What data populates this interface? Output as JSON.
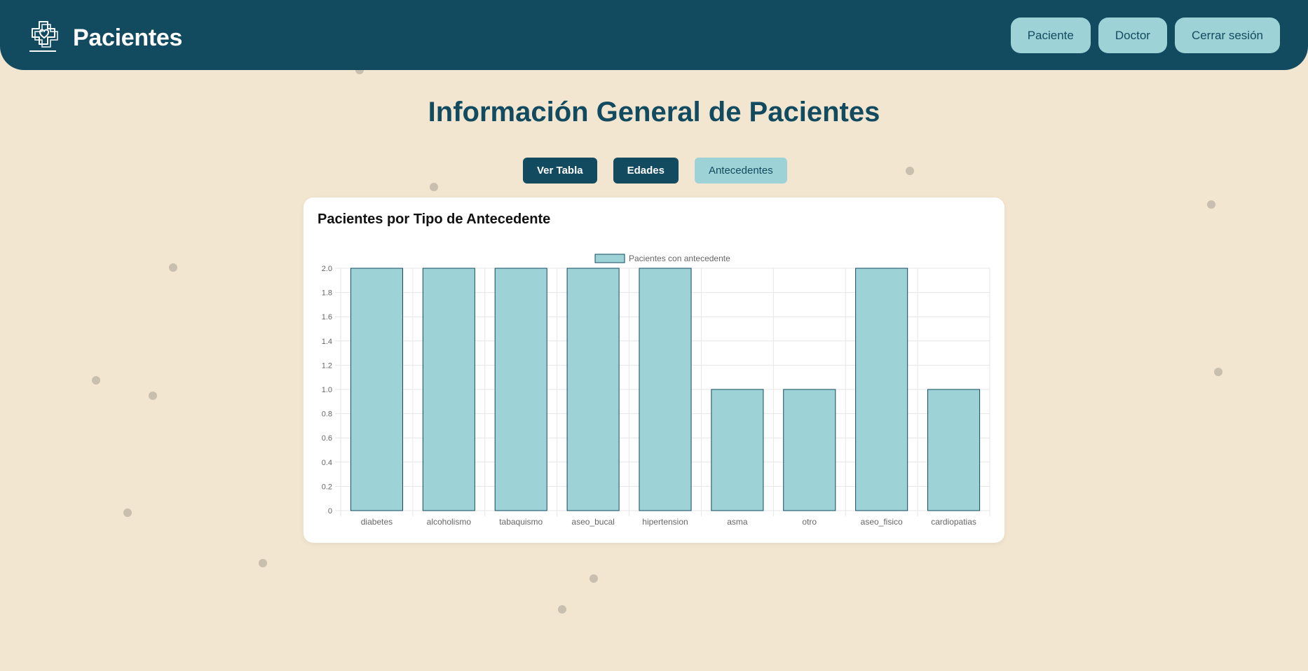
{
  "header": {
    "title": "Pacientes",
    "logo_icon": "heart-cross-logo-icon",
    "nav": [
      {
        "label": "Paciente"
      },
      {
        "label": "Doctor"
      },
      {
        "label": "Cerrar sesión"
      }
    ]
  },
  "main": {
    "title": "Información General de Pacientes",
    "tabs": [
      {
        "label": "Ver Tabla",
        "active": false
      },
      {
        "label": "Edades",
        "active": false
      },
      {
        "label": "Antecedentes",
        "active": true
      }
    ]
  },
  "card": {
    "title": "Pacientes por Tipo de Antecedente"
  },
  "chart_data": {
    "type": "bar",
    "categories": [
      "diabetes",
      "alcoholismo",
      "tabaquismo",
      "aseo_bucal",
      "hipertension",
      "asma",
      "otro",
      "aseo_fisico",
      "cardiopatias"
    ],
    "series": [
      {
        "name": "Pacientes con antecedente",
        "values": [
          2,
          2,
          2,
          2,
          2,
          1,
          1,
          2,
          1
        ]
      }
    ],
    "ylim": [
      0,
      2
    ],
    "yticks": [
      "0",
      "0.2",
      "0.4",
      "0.6",
      "0.8",
      "1.0",
      "1.2",
      "1.4",
      "1.6",
      "1.8",
      "2.0"
    ],
    "xlabel": "",
    "ylabel": "",
    "grid": true,
    "legend": "top",
    "colors": {
      "bar_fill": "#9dd2d6",
      "bar_stroke": "#124b60",
      "grid": "#e6e6e6",
      "tick_text": "#666666"
    }
  },
  "colors": {
    "primary": "#124b60",
    "accent": "#9dd2d6",
    "background": "#f2e6d0"
  }
}
